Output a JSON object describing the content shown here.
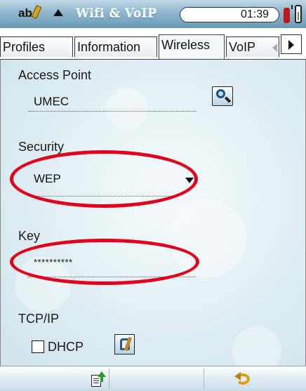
{
  "status": {
    "input_mode": "ab",
    "app_title": "Wifi & VoIP",
    "time": "01:39"
  },
  "tabs": [
    {
      "label": "Profiles",
      "active": false
    },
    {
      "label": "Information",
      "active": false
    },
    {
      "label": "Wireless",
      "active": true
    },
    {
      "label": "VoIP",
      "active": false
    }
  ],
  "wireless": {
    "access_point_label": "Access Point",
    "access_point_value": "UMEC",
    "security_label": "Security",
    "security_value": "WEP",
    "key_label": "Key",
    "key_value": "**********",
    "tcpip_label": "TCP/IP",
    "dhcp_label": "DHCP",
    "dhcp_checked": false
  },
  "highlight_color": "#e3001b",
  "icons": [
    "pen-icon",
    "up-arrow-icon",
    "signal-icon",
    "battery-icon",
    "search-icon",
    "settings-tool-icon",
    "export-icon",
    "back-icon"
  ]
}
